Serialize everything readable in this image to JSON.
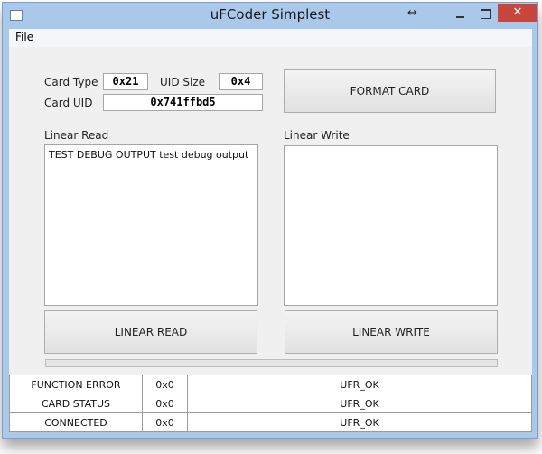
{
  "window": {
    "title": "uFCoder Simplest",
    "close_glyph": "✕",
    "resize_glyph": "↔"
  },
  "menu": {
    "file": "File"
  },
  "card": {
    "type_label": "Card Type",
    "type_value": "0x21",
    "uid_size_label": "UID Size",
    "uid_size_value": "0x4",
    "uid_label": "Card UID",
    "uid_value": "0x741ffbd5"
  },
  "buttons": {
    "format_card": "FORMAT CARD",
    "linear_read": "LINEAR READ",
    "linear_write": "LINEAR WRITE"
  },
  "linear_read": {
    "label": "Linear Read",
    "content": "TEST DEBUG OUTPUT test debug output"
  },
  "linear_write": {
    "label": "Linear Write",
    "content": ""
  },
  "progress": {
    "value": 0
  },
  "status_rows": [
    {
      "name": "FUNCTION ERROR",
      "code": "0x0",
      "message": "UFR_OK"
    },
    {
      "name": "CARD STATUS",
      "code": "0x0",
      "message": "UFR_OK"
    },
    {
      "name": "CONNECTED",
      "code": "0x0",
      "message": "UFR_OK"
    }
  ],
  "icons": {
    "app": "app-icon",
    "resize": "resize-arrows-icon",
    "minimize": "minimize-icon",
    "maximize": "maximize-icon",
    "close": "close-icon"
  },
  "colors": {
    "title_bar": "#a9c8ea",
    "close_button": "#c7463d",
    "client_bg": "#f0f0f0"
  }
}
